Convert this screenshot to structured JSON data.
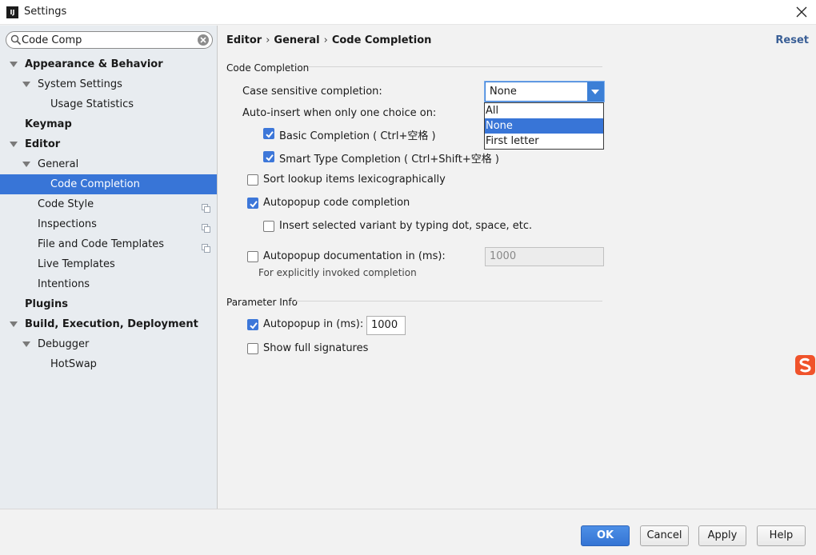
{
  "window": {
    "title": "Settings",
    "app_icon_text": "IJ"
  },
  "search": {
    "value": "Code Comp"
  },
  "tree": [
    {
      "label": "Appearance & Behavior",
      "bold": true,
      "arrow": true
    },
    {
      "label": "System Settings",
      "bold": false,
      "arrow": true
    },
    {
      "label": "Usage Statistics",
      "bold": false,
      "arrow": false
    },
    {
      "label": "Keymap",
      "bold": true,
      "arrow": false
    },
    {
      "label": "Editor",
      "bold": true,
      "arrow": true
    },
    {
      "label": "General",
      "bold": false,
      "arrow": true
    },
    {
      "label": "Code Completion",
      "bold": false,
      "arrow": false,
      "selected": true
    },
    {
      "label": "Code Style",
      "bold": false,
      "arrow": false,
      "copy_icon": true
    },
    {
      "label": "Inspections",
      "bold": false,
      "arrow": false,
      "copy_icon": true
    },
    {
      "label": "File and Code Templates",
      "bold": false,
      "arrow": false,
      "copy_icon": true
    },
    {
      "label": "Live Templates",
      "bold": false,
      "arrow": false
    },
    {
      "label": "Intentions",
      "bold": false,
      "arrow": false
    },
    {
      "label": "Plugins",
      "bold": true,
      "arrow": false
    },
    {
      "label": "Build, Execution, Deployment",
      "bold": true,
      "arrow": true
    },
    {
      "label": "Debugger",
      "bold": false,
      "arrow": true
    },
    {
      "label": "HotSwap",
      "bold": false,
      "arrow": false
    }
  ],
  "breadcrumb": {
    "parts": [
      "Editor",
      "General",
      "Code Completion"
    ],
    "separator": "›"
  },
  "reset_label": "Reset",
  "code_completion": {
    "section_title": "Code Completion",
    "case_sensitive_label": "Case sensitive completion:",
    "case_sensitive_value": "None",
    "case_sensitive_options": [
      "All",
      "None",
      "First letter"
    ],
    "auto_insert_label": "Auto-insert when only one choice on:",
    "basic_completion": {
      "label": "Basic Completion ( Ctrl+空格 )",
      "checked": true
    },
    "smart_type_completion": {
      "label": "Smart Type Completion ( Ctrl+Shift+空格 )",
      "checked": true
    },
    "sort_lexicographically": {
      "label": "Sort lookup items lexicographically",
      "checked": false
    },
    "autopopup_code": {
      "label": "Autopopup code completion",
      "checked": true
    },
    "insert_variant": {
      "label": "Insert selected variant by typing dot, space, etc.",
      "checked": false
    },
    "autopopup_docs": {
      "label": "Autopopup documentation in (ms):",
      "checked": false,
      "value": "1000"
    },
    "autopopup_docs_hint": "For explicitly invoked completion"
  },
  "parameter_info": {
    "section_title": "Parameter Info",
    "autopopup": {
      "label": "Autopopup in (ms):",
      "checked": true,
      "value": "1000"
    },
    "show_full_signatures": {
      "label": "Show full signatures",
      "checked": false
    }
  },
  "footer": {
    "ok": "OK",
    "cancel": "Cancel",
    "apply": "Apply",
    "help": "Help"
  },
  "colors": {
    "accent": "#3875d7",
    "link": "#3a5f96",
    "sidebar_bg": "#e8ecf0"
  }
}
